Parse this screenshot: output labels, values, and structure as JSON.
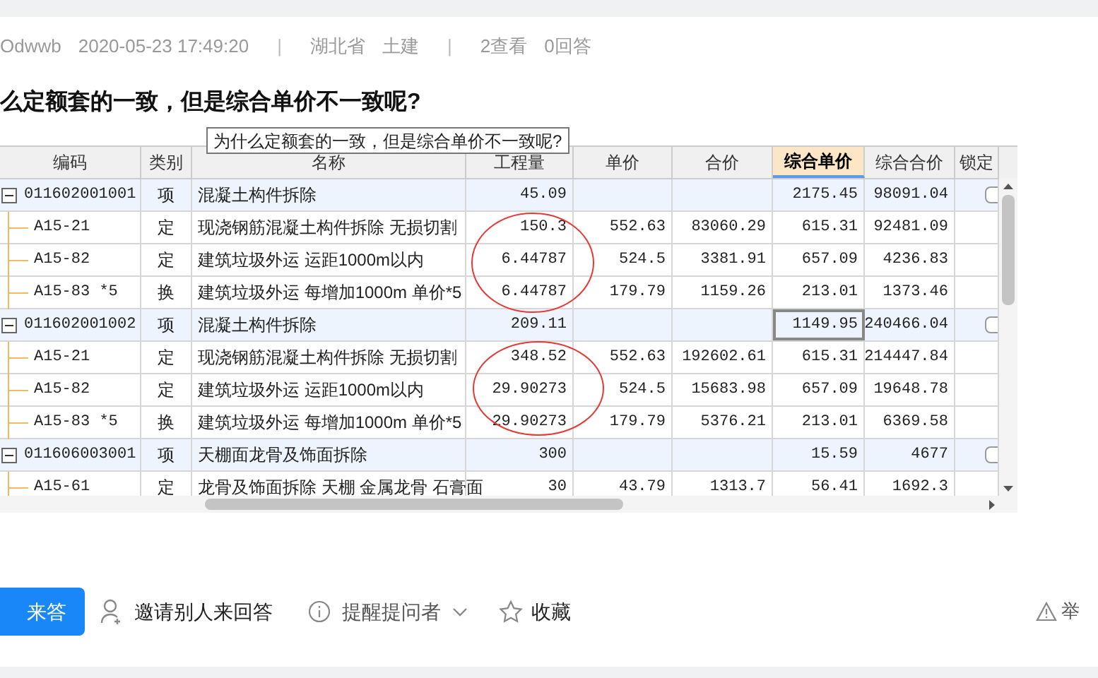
{
  "meta": [
    {
      "kind": "text",
      "text": "Odwwb"
    },
    {
      "kind": "text",
      "text": "2020-05-23 17:49:20"
    },
    {
      "kind": "separator",
      "text": "|"
    },
    {
      "kind": "text",
      "text": "湖北省"
    },
    {
      "kind": "text",
      "text": "土建"
    },
    {
      "kind": "separator",
      "text": "|"
    },
    {
      "kind": "text",
      "text": "2查看"
    },
    {
      "kind": "text",
      "text": "0回答"
    }
  ],
  "title": "么定额套的一致，但是综合单价不一致呢?",
  "sheet": {
    "tooltip": "为什么定额套的一致，但是综合单价不一致呢?",
    "columns": [
      {
        "label": "编码",
        "selected": false
      },
      {
        "label": "类别",
        "selected": false
      },
      {
        "label": "名称",
        "selected": false
      },
      {
        "label": "工程量",
        "selected": false
      },
      {
        "label": "单价",
        "selected": false
      },
      {
        "label": "合价",
        "selected": false
      },
      {
        "label": "综合单价",
        "selected": true
      },
      {
        "label": "综合合价",
        "selected": false
      },
      {
        "label": "锁定",
        "selected": false
      }
    ],
    "rows": [
      {
        "code": "011602001001",
        "type": "项",
        "name": "混凝土构件拆除",
        "qty": "45.09",
        "price": "",
        "total": "",
        "unit_price": "2175.45",
        "sum": "98091.04",
        "focused": false,
        "expanded": true,
        "locked": false,
        "children": [
          {
            "code": "A15-21",
            "type": "定",
            "name": "现浇钢筋混凝土构件拆除 无损切割",
            "qty": "150.3",
            "price": "552.63",
            "total": "83060.29",
            "unit_price": "615.31",
            "sum": "92481.09",
            "focused": false
          },
          {
            "code": "A15-82",
            "type": "定",
            "name": "建筑垃圾外运 运距1000m以内",
            "qty": "6.44787",
            "price": "524.5",
            "total": "3381.91",
            "unit_price": "657.09",
            "sum": "4236.83",
            "focused": false
          },
          {
            "code": "A15-83 *5",
            "type": "换",
            "name": "建筑垃圾外运 每增加1000m  单价*5",
            "qty": "6.44787",
            "price": "179.79",
            "total": "1159.26",
            "unit_price": "213.01",
            "sum": "1373.46",
            "focused": false
          }
        ]
      },
      {
        "code": "011602001002",
        "type": "项",
        "name": "混凝土构件拆除",
        "qty": "209.11",
        "price": "",
        "total": "",
        "unit_price": "1149.95",
        "sum": "240466.04",
        "focused": true,
        "expanded": true,
        "locked": false,
        "children": [
          {
            "code": "A15-21",
            "type": "定",
            "name": "现浇钢筋混凝土构件拆除 无损切割",
            "qty": "348.52",
            "price": "552.63",
            "total": "192602.61",
            "unit_price": "615.31",
            "sum": "214447.84",
            "focused": false
          },
          {
            "code": "A15-82",
            "type": "定",
            "name": "建筑垃圾外运 运距1000m以内",
            "qty": "29.90273",
            "price": "524.5",
            "total": "15683.98",
            "unit_price": "657.09",
            "sum": "19648.78",
            "focused": false
          },
          {
            "code": "A15-83 *5",
            "type": "换",
            "name": "建筑垃圾外运 每增加1000m  单价*5",
            "qty": "29.90273",
            "price": "179.79",
            "total": "5376.21",
            "unit_price": "213.01",
            "sum": "6369.58",
            "focused": false
          }
        ]
      },
      {
        "code": "011606003001",
        "type": "项",
        "name": "天棚面龙骨及饰面拆除",
        "qty": "300",
        "price": "",
        "total": "",
        "unit_price": "15.59",
        "sum": "4677",
        "focused": false,
        "expanded": true,
        "locked": false,
        "children": [
          {
            "code": "A15-61",
            "type": "定",
            "name": "龙骨及饰面拆除 天棚 金属龙骨 石膏面",
            "qty": "30",
            "price": "43.79",
            "total": "1313.7",
            "unit_price": "56.41",
            "sum": "1692.3",
            "focused": false
          }
        ]
      }
    ]
  },
  "actions": {
    "answer": "来答",
    "invite": "邀请别人来回答",
    "remind": "提醒提问者",
    "favorite": "收藏",
    "report": "举"
  }
}
